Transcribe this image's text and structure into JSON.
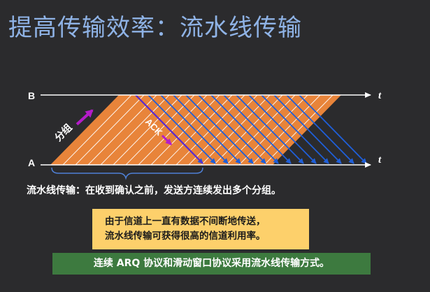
{
  "title": "提高传输效率：流水线传输",
  "diagram": {
    "top_line_label": "B",
    "bottom_line_label": "A",
    "time_label": "t",
    "packet_label": "分组",
    "ack_label": "ACK",
    "colors": {
      "background": "#2b2b2d",
      "band_fill": "#e8843a",
      "ack_arrow": "#1f5fd9",
      "packet_arrow": "#b41cc9",
      "brace": "#4f80d6",
      "axis": "#ffffff"
    }
  },
  "caption": "流水线传输：在收到确认之前，发送方连续发出多个分组。",
  "note": {
    "line1": "由于信道上一直有数据不间断地传送，",
    "line2": "流水线传输可获得很高的信道利用率。"
  },
  "footer": "连续 ARQ 协议和滑动窗口协议采用流水线传输方式。"
}
